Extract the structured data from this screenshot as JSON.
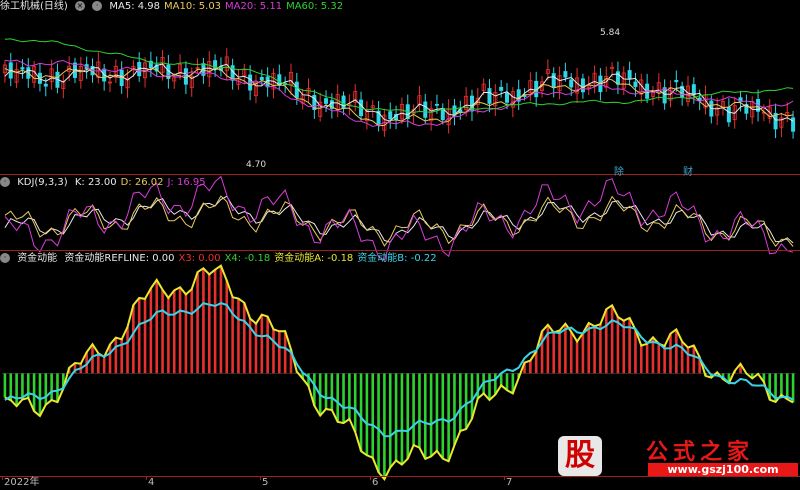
{
  "panels": {
    "price": {
      "title": "徐工机械(日线)",
      "legend": [
        {
          "text": "MA5: 4.98",
          "color": "#e8e8e8"
        },
        {
          "text": "MA10: 5.03",
          "color": "#e8c95e"
        },
        {
          "text": "MA20: 5.11",
          "color": "#d83cd8"
        },
        {
          "text": "MA60: 5.32",
          "color": "#2fd12f"
        }
      ],
      "high_label": "5.84",
      "low_label": "4.70",
      "tags": [
        "除",
        "财"
      ]
    },
    "kdj": {
      "title": "KDJ(9,3,3)",
      "legend": [
        {
          "text": "K: 23.00",
          "color": "#e8e8e8"
        },
        {
          "text": "D: 26.02",
          "color": "#e8c95e"
        },
        {
          "text": "J: 16.95",
          "color": "#d83cd8"
        }
      ]
    },
    "flow": {
      "title": "资金动能",
      "legend": [
        {
          "text": "资金动能REFLINE: 0.00",
          "color": "#e8e8e8"
        },
        {
          "text": "X3: 0.00",
          "color": "#e8312f"
        },
        {
          "text": "X4: -0.18",
          "color": "#2fd12f"
        },
        {
          "text": "资金动能A: -0.18",
          "color": "#e8e82f"
        },
        {
          "text": "资金动能B: -0.22",
          "color": "#3ad3e8"
        }
      ]
    }
  },
  "x_axis": {
    "ticks": [
      "2022年",
      "4",
      "5",
      "6",
      "7"
    ]
  },
  "watermark": {
    "seal": "股",
    "name": "公式之家",
    "url": "www.gszj100.com"
  },
  "colors": {
    "up": "#e8312f",
    "down": "#2fd6e8",
    "ma5": "#e8e8e8",
    "ma10": "#e8c95e",
    "ma20": "#d83cd8",
    "ma60": "#2fd12f",
    "flow_up": "#e8312f",
    "flow_down": "#2fd12f",
    "flow_a": "#e8e82f",
    "flow_b": "#3ad3e8"
  },
  "chart_data": [
    {
      "type": "line",
      "title": "徐工机械(日线)",
      "x": [
        "2022-03",
        "2022-04",
        "2022-05",
        "2022-06",
        "2022-07"
      ],
      "series": [
        {
          "name": "MA5",
          "values": [
            5.45,
            5.5,
            5.12,
            5.42,
            5.1
          ]
        },
        {
          "name": "MA10",
          "values": [
            5.47,
            5.48,
            5.05,
            5.38,
            5.13
          ]
        },
        {
          "name": "MA20",
          "values": [
            5.58,
            5.46,
            5.02,
            5.34,
            5.2
          ]
        },
        {
          "name": "MA60",
          "values": [
            5.78,
            5.55,
            5.14,
            5.22,
            5.33
          ]
        }
      ],
      "annotations": [
        "5.84",
        "4.70"
      ],
      "ylim": [
        4.6,
        5.95
      ]
    },
    {
      "type": "line",
      "title": "KDJ(9,3,3)",
      "series": [
        {
          "name": "K",
          "values": [
            35,
            70,
            30,
            65,
            23
          ]
        },
        {
          "name": "D",
          "values": [
            40,
            62,
            35,
            60,
            26.02
          ]
        },
        {
          "name": "J",
          "values": [
            20,
            90,
            15,
            85,
            16.95
          ]
        }
      ],
      "ylim": [
        0,
        100
      ]
    },
    {
      "type": "bar",
      "title": "资金动能",
      "x": [
        "2022-03",
        "2022-04",
        "2022-05",
        "2022-06",
        "2022-07"
      ],
      "series": [
        {
          "name": "资金动能A",
          "values": [
            -0.4,
            1.0,
            -0.95,
            0.55,
            -0.18
          ]
        },
        {
          "name": "资金动能B",
          "values": [
            -0.3,
            0.7,
            -0.6,
            0.5,
            -0.22
          ]
        }
      ],
      "reference": 0.0,
      "ylim": [
        -1.05,
        1.1
      ]
    }
  ]
}
